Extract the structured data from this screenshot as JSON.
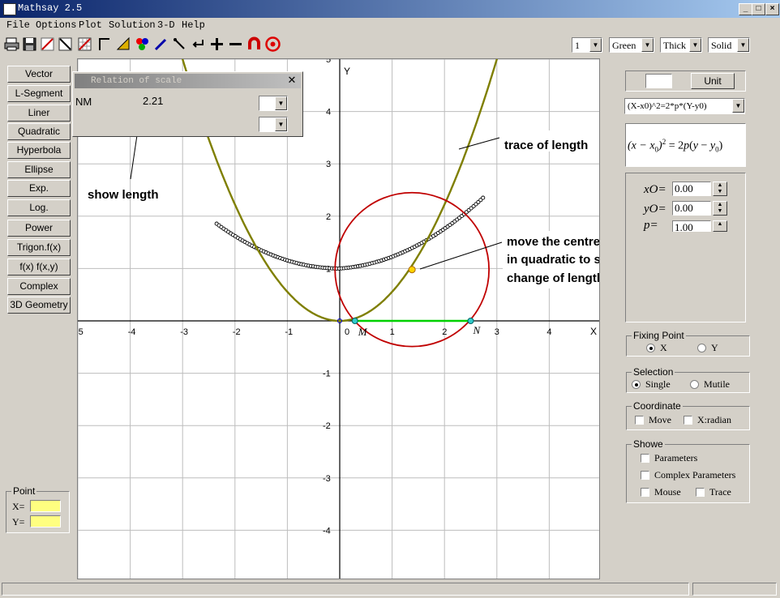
{
  "window": {
    "title": "Mathsay 2.5"
  },
  "menu": [
    "File",
    "Options",
    "Plot",
    "Solution",
    "3-D",
    "Help"
  ],
  "toolbar": {
    "line_width": "1",
    "color": "Green",
    "thickness": "Thick",
    "style": "Solid"
  },
  "left_buttons": [
    "Vector",
    "L-Segment",
    "Liner",
    "Quadratic",
    "Hyperbola",
    "Ellipse",
    "Exp.",
    "Log.",
    "Power",
    "Trigon.f(x)",
    "f(x)  f(x,y)",
    "Complex",
    "3D Geometry"
  ],
  "point_box": {
    "title": "Point",
    "x_label": "X=",
    "y_label": "Y=",
    "x_value": "",
    "y_value": ""
  },
  "popup": {
    "title": "Relation of scale",
    "label": "NM",
    "value": "2.21"
  },
  "plot": {
    "x_axis_label": "X",
    "y_axis_label": "Y",
    "x_ticks": [
      "-5",
      "-4",
      "-3",
      "-2",
      "-1",
      "0",
      "1",
      "2",
      "3",
      "4"
    ],
    "y_ticks": [
      "5",
      "4",
      "3",
      "2",
      "1",
      "-1",
      "-2",
      "-3",
      "-4"
    ],
    "point_m": "M",
    "point_n": "N",
    "xlim": [
      -5,
      5
    ],
    "ylim": [
      -5,
      5
    ],
    "parabola_p": 0.9,
    "circle_center": [
      1.38,
      0.98
    ],
    "circle_radius": 1.47,
    "m_x": 0.29,
    "n_x": 2.5,
    "colors": {
      "parabola": "#7f7f00",
      "circle": "#c00000",
      "segment": "#00d000",
      "trace": "#000000",
      "center": "#ffd400"
    }
  },
  "annotations": {
    "show_length": "show length",
    "trace": "trace of length",
    "move_line1": "move the centre of circle",
    "move_line2": "in quadratic to show the",
    "move_line3": "change of length MN"
  },
  "right_panel": {
    "unit_button": "Unit",
    "unit_value": "",
    "equation_select": "(X-x0)^2=2*p*(Y-y0)",
    "params": [
      {
        "label": "xO=",
        "value": "0.00"
      },
      {
        "label": "yO=",
        "value": "0.00"
      },
      {
        "label": "p=",
        "value": "1.00"
      }
    ],
    "fixing_point": {
      "title": "Fixing Point",
      "x": "X",
      "y": "Y"
    },
    "selection": {
      "title": "Selection",
      "single": "Single",
      "mutile": "Mutile"
    },
    "coordinate": {
      "title": "Coordinate",
      "move": "Move",
      "xradian": "X:radian"
    },
    "showe": {
      "title": "Showe",
      "parameters": "Parameters",
      "complex": "Complex Parameters",
      "mouse": "Mouse",
      "trace": "Trace"
    }
  }
}
